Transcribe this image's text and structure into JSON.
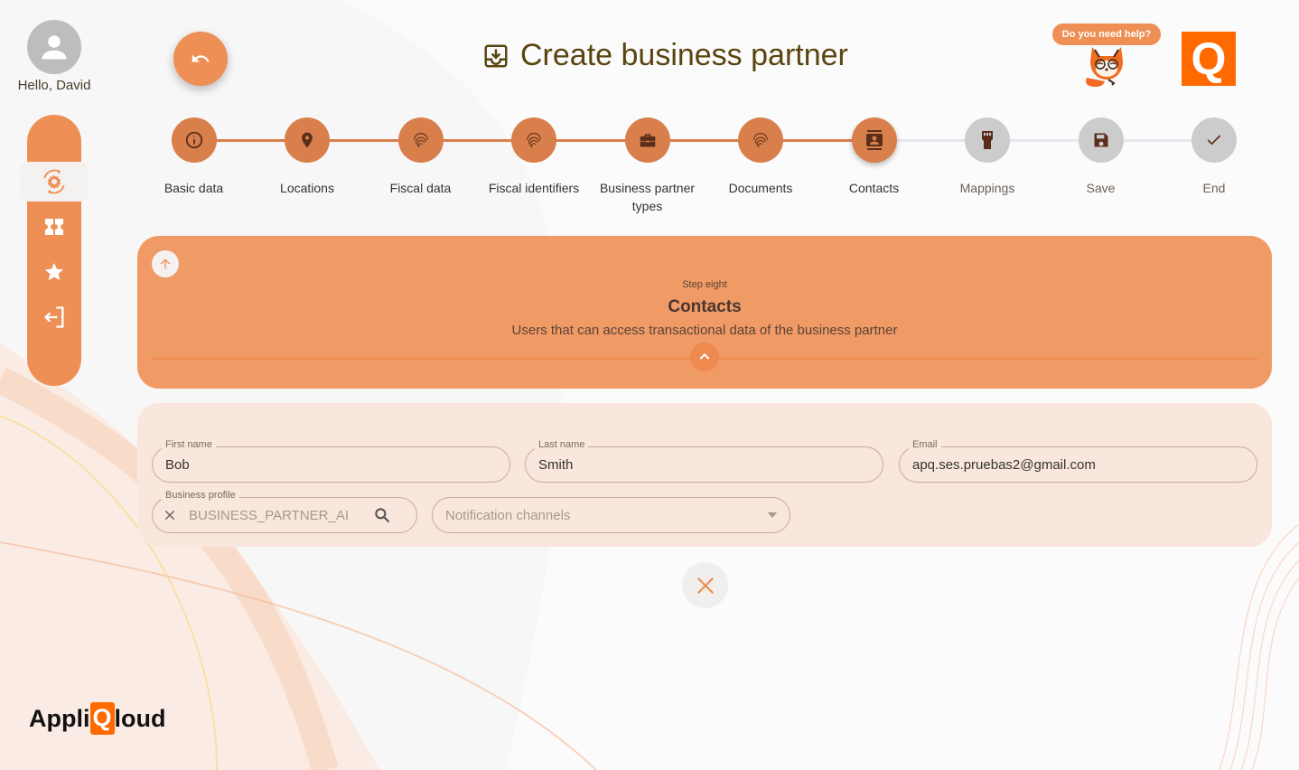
{
  "user": {
    "greeting": "Hello, David",
    "avatar_icon": "account-circle-icon"
  },
  "sidebar": {
    "items": [
      {
        "name": "settings-sync",
        "icon": "settings-sync-icon",
        "active": true
      },
      {
        "name": "tickets",
        "icon": "ticket-icon",
        "active": false
      },
      {
        "name": "favorites",
        "icon": "star-icon",
        "active": false
      },
      {
        "name": "logout",
        "icon": "logout-icon",
        "active": false
      }
    ]
  },
  "header": {
    "back_icon": "undo-icon",
    "title": "Create business partner",
    "title_icon": "inbox-download-icon",
    "help_text": "Do you need help?",
    "logo_letter": "Q"
  },
  "stepper": {
    "current_index": 6,
    "steps": [
      {
        "label": "Basic data",
        "icon": "info-icon",
        "state": "done"
      },
      {
        "label": "Locations",
        "icon": "location-pin-icon",
        "state": "done"
      },
      {
        "label": "Fiscal data",
        "icon": "fingerprint-icon",
        "state": "done"
      },
      {
        "label": "Fiscal identifiers",
        "icon": "fingerprint-icon",
        "state": "done"
      },
      {
        "label": "Business partner types",
        "icon": "briefcase-icon",
        "state": "done"
      },
      {
        "label": "Documents",
        "icon": "fingerprint-icon",
        "state": "done"
      },
      {
        "label": "Contacts",
        "icon": "contact-card-icon",
        "state": "current"
      },
      {
        "label": "Mappings",
        "icon": "connector-icon",
        "state": "pending"
      },
      {
        "label": "Save",
        "icon": "save-icon",
        "state": "pending"
      },
      {
        "label": "End",
        "icon": "check-icon",
        "state": "pending"
      }
    ],
    "colors": {
      "done": "#d97f4b",
      "pending": "#cccccc",
      "icon": "#5a2e1a",
      "line_done": "#d97f4b",
      "line_pending": "#e8e6ee"
    }
  },
  "step_info": {
    "subtitle": "Step eight",
    "title": "Contacts",
    "description": "Users that can access transactional data of the business partner"
  },
  "form": {
    "first_name": {
      "label": "First name",
      "value": "Bob"
    },
    "last_name": {
      "label": "Last name",
      "value": "Smith"
    },
    "email": {
      "label": "Email",
      "value": "apq.ses.pruebas2@gmail.com"
    },
    "business_profile": {
      "label": "Business profile",
      "value": "BUSINESS_PARTNER_AI"
    },
    "notification_channels": {
      "placeholder": "Notification channels"
    }
  },
  "brand": {
    "prefix": "Appli",
    "q": "Q",
    "suffix": "loud"
  },
  "colors": {
    "accent": "#ee8f55",
    "panel": "#f09a66",
    "form_bg": "#f9e6dc",
    "title": "#5a4510"
  }
}
